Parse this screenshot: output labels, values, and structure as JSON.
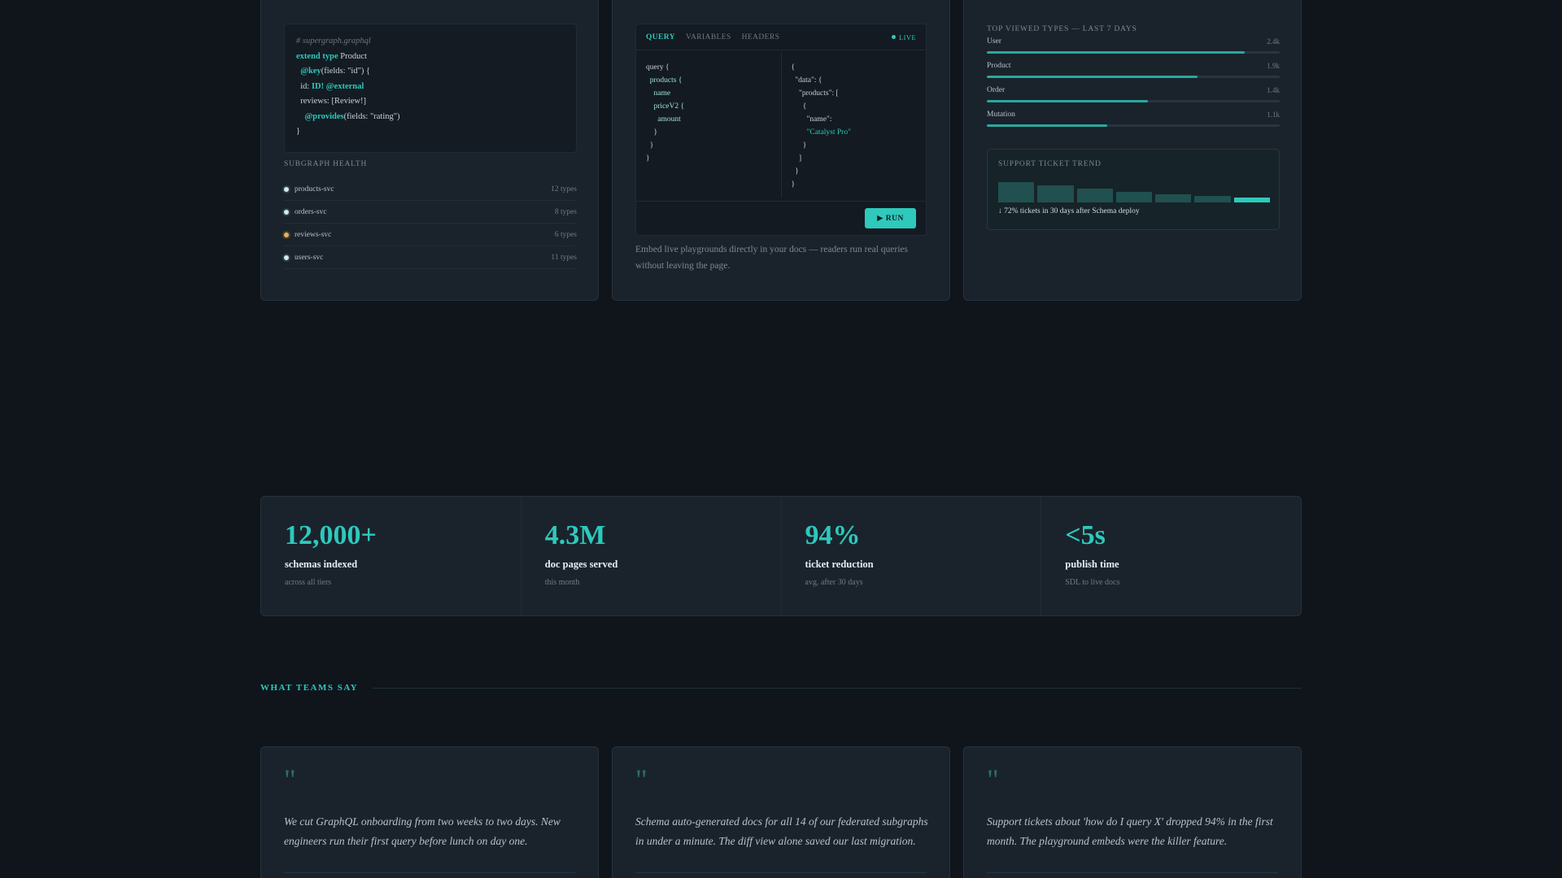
{
  "schema_card": {
    "code": {
      "comment": "# supergraph.graphql",
      "line1_kw": "extend type",
      "line1_name": " Product",
      "line2_dir": "@key",
      "line2_rest": "(fields: \"id\") {",
      "line3_field": "id: ",
      "line3_type": "ID!",
      "line3_dir": " @external",
      "line4": "reviews: [Review!]",
      "line5_dir": "@provides",
      "line5_rest": "(fields: \"rating\")",
      "line6": "}"
    },
    "health_label": "SUBGRAPH HEALTH",
    "subgraphs": [
      {
        "name": "products-svc",
        "types": "12 types",
        "status": "ok"
      },
      {
        "name": "orders-svc",
        "types": "8 types",
        "status": "ok"
      },
      {
        "name": "reviews-svc",
        "types": "6 types",
        "status": "warn"
      },
      {
        "name": "users-svc",
        "types": "11 types",
        "status": "ok"
      }
    ]
  },
  "playground_card": {
    "tabs": [
      "QUERY",
      "VARIABLES",
      "HEADERS"
    ],
    "active_tab": "QUERY",
    "live_label": "LIVE",
    "query_lines": [
      "query {",
      "  products {",
      "    name",
      "    priceV2 {",
      "      amount",
      "    }",
      "  }",
      "}"
    ],
    "response_lines": [
      "{",
      "  \"data\": {",
      "    \"products\": [",
      "      {",
      "        \"name\":",
      "        \"Catalyst Pro\"",
      "      }",
      "    ]",
      "  }",
      "}"
    ],
    "run_label": "▶ RUN",
    "caption": "Embed live playgrounds directly in your docs — readers run real queries without leaving the page."
  },
  "analytics_card": {
    "top_label": "TOP VIEWED TYPES — LAST 7 DAYS",
    "types": [
      {
        "name": "User",
        "value": "2.4k",
        "fraction": 0.88
      },
      {
        "name": "Product",
        "value": "1.9k",
        "fraction": 0.72
      },
      {
        "name": "Order",
        "value": "1.4k",
        "fraction": 0.55
      },
      {
        "name": "Mutation",
        "value": "1.1k",
        "fraction": 0.41
      }
    ],
    "trend_label": "SUPPORT TICKET TREND",
    "trend_levels": [
      1.0,
      0.84,
      0.68,
      0.52,
      0.4,
      0.3,
      0.2
    ],
    "trend_note": "↓ 72% tickets in 30 days after Schema deploy"
  },
  "stats": [
    {
      "value": "12,000+",
      "title": "schemas indexed",
      "sub": "across all tiers"
    },
    {
      "value": "4.3M",
      "title": "doc pages served",
      "sub": "this month"
    },
    {
      "value": "94%",
      "title": "ticket reduction",
      "sub": "avg. after 30 days"
    },
    {
      "value": "<5s",
      "title": "publish time",
      "sub": "SDL to live docs"
    }
  ],
  "testimonials_heading": "WHAT TEAMS SAY",
  "testimonials": [
    {
      "mark": "\"",
      "text": "We cut GraphQL onboarding from two weeks to two days. New engineers run their first query before lunch on day one."
    },
    {
      "mark": "\"",
      "text": "Schema auto-generated docs for all 14 of our federated subgraphs in under a minute. The diff view alone saved our last migration."
    },
    {
      "mark": "\"",
      "text": "Support tickets about 'how do I query X' dropped 94% in the first month. The playground embeds were the killer feature."
    }
  ],
  "colors": {
    "accent": "#2ec9bc",
    "background": "#0f151b",
    "card": "#1a232c",
    "warn": "#e0b35a"
  }
}
